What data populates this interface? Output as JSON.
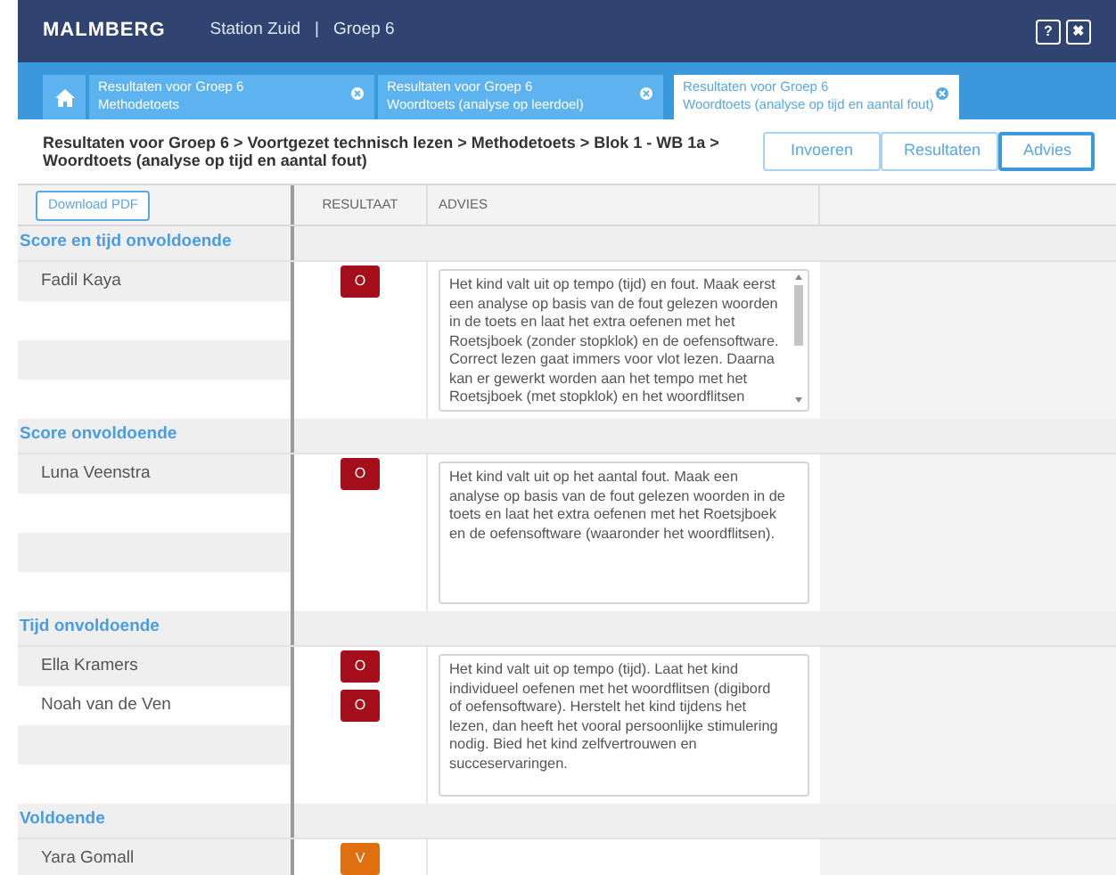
{
  "header": {
    "logo": "MALMBERG",
    "school": "Station Zuid",
    "separator": "|",
    "group": "Groep 6",
    "buttons": [
      "?",
      "✖"
    ]
  },
  "tabs": [
    {
      "title": "Resultaten voor Groep 6",
      "subtitle": "Methodetoets",
      "selected": false
    },
    {
      "title": "Resultaten voor Groep 6",
      "subtitle": "Woordtoets (analyse op leerdoel)",
      "selected": false
    },
    {
      "title": "Resultaten voor Groep 6",
      "subtitle": "Woordtoets (analyse op tijd en aantal fout)",
      "selected": true
    }
  ],
  "breadcrumb": "Resultaten voor Groep 6 > Voortgezet technisch lezen > Methodetoets > Blok 1 - WB 1a > Woordtoets (analyse op tijd en aantal fout)",
  "view_buttons": [
    {
      "label": "Invoeren",
      "selected": false
    },
    {
      "label": "Resultaten",
      "selected": false
    },
    {
      "label": "Advies",
      "selected": true
    }
  ],
  "download_button": "Download PDF",
  "columns": [
    "RESULTAAT",
    "ADVIES"
  ],
  "groups": [
    {
      "title": "Score en tijd onvoldoende",
      "students": [
        {
          "name": "Fadil Kaya",
          "result": "O",
          "color": "#a50f1c"
        }
      ],
      "advice": "Het kind valt uit op tempo (tijd) en fout. Maak eerst een analyse op basis van de fout gelezen woorden in de toets en laat het extra oefenen met het Roetsjboek (zonder stopklok) en de oefensoftware. Correct lezen gaat immers voor vlot lezen. Daarna kan er gewerkt worden aan het tempo met het Roetsjboek (met stopklok) en het woordflitsen",
      "scrollbar": true
    },
    {
      "title": "Score onvoldoende",
      "students": [
        {
          "name": "Luna Veenstra",
          "result": "O",
          "color": "#a50f1c"
        }
      ],
      "advice": "Het kind valt uit op het aantal fout. Maak een analyse op basis van de fout gelezen woorden in de toets en laat het extra oefenen met het Roetsjboek en de oefensoftware (waaronder het woordflitsen).",
      "scrollbar": false
    },
    {
      "title": "Tijd onvoldoende",
      "students": [
        {
          "name": "Ella Kramers",
          "result": "O",
          "color": "#a50f1c"
        },
        {
          "name": "Noah van de Ven",
          "result": "O",
          "color": "#a50f1c"
        }
      ],
      "advice": "Het kind valt uit op tempo (tijd). Laat het kind individueel oefenen met het woordflitsen (digibord of oefensoftware). Herstelt het kind tijdens het lezen, dan heeft het vooral persoonlijke stimulering nodig. Bied het kind zelfvertrouwen en succeservaringen.",
      "scrollbar": false
    },
    {
      "title": "Voldoende",
      "students": [
        {
          "name": "Yara Gomall",
          "result": "V",
          "color": "#e0700f"
        }
      ]
    }
  ]
}
